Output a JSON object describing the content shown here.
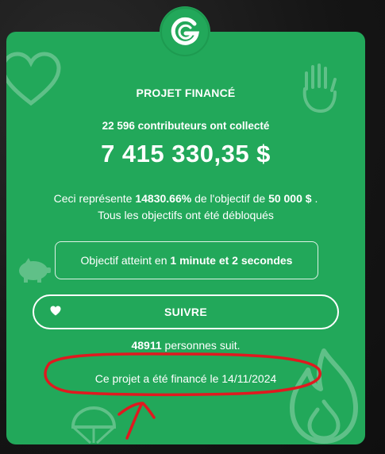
{
  "logo": {
    "icon": "g-logo-icon"
  },
  "status": {
    "title": "PROJET FINANCÉ"
  },
  "stats": {
    "contributors_count": "22 596",
    "contributors_suffix": "contributeurs ont collecté",
    "amount": "7 415 330,35 $"
  },
  "goal": {
    "desc_prefix": "Ceci représente",
    "percent": "14830.66%",
    "desc_middle": "de l'objectif de",
    "goal_amount": "50 000 $",
    "desc_end": ".",
    "unlocked": "Tous les objectifs ont été débloqués"
  },
  "reached": {
    "prefix": "Objectif atteint en",
    "duration": "1 minute et 2 secondes"
  },
  "follow": {
    "label": "SUIVRE",
    "icon": "heart-icon",
    "count": "48911",
    "count_suffix": "personnes suit."
  },
  "funded": {
    "text": "Ce projet a été financé le 14/11/2024"
  },
  "colors": {
    "card": "#22a85a",
    "background": "#151515",
    "annotation": "#e0191f",
    "text": "#ffffff"
  }
}
